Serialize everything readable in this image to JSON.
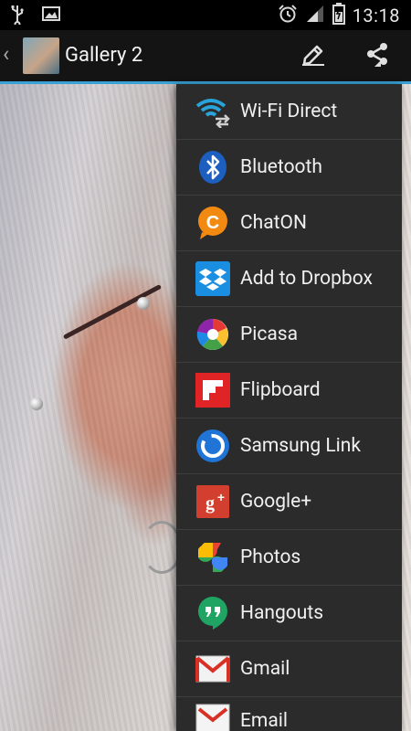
{
  "status_bar": {
    "left_icons": [
      "usb-icon",
      "image-notification-icon"
    ],
    "right_icons": [
      "alarm-icon",
      "signal-icon",
      "battery-icon"
    ],
    "time": "13:18"
  },
  "action_bar": {
    "title": "Gallery 2",
    "actions": [
      "edit-icon",
      "share-icon"
    ],
    "accent_color": "#39a1d6"
  },
  "share_menu": {
    "items": [
      {
        "label": "Wi-Fi Direct",
        "icon": "wifi-direct-icon"
      },
      {
        "label": "Bluetooth",
        "icon": "bluetooth-icon"
      },
      {
        "label": "ChatON",
        "icon": "chaton-icon"
      },
      {
        "label": "Add to Dropbox",
        "icon": "dropbox-icon"
      },
      {
        "label": "Picasa",
        "icon": "picasa-icon"
      },
      {
        "label": "Flipboard",
        "icon": "flipboard-icon"
      },
      {
        "label": "Samsung Link",
        "icon": "samsung-link-icon"
      },
      {
        "label": "Google+",
        "icon": "google-plus-icon"
      },
      {
        "label": "Photos",
        "icon": "photos-icon"
      },
      {
        "label": "Hangouts",
        "icon": "hangouts-icon"
      },
      {
        "label": "Gmail",
        "icon": "gmail-icon"
      },
      {
        "label": "Email",
        "icon": "email-icon"
      }
    ]
  }
}
